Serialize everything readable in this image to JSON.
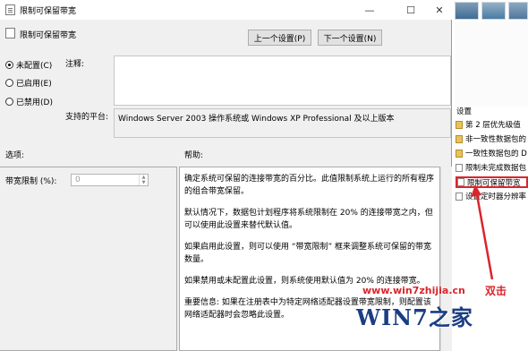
{
  "window": {
    "title": "限制可保留带宽",
    "controls": {
      "minimize": "—",
      "maximize": "☐",
      "close": "✕"
    }
  },
  "policy_header": "限制可保留带宽",
  "nav": {
    "prev": "上一个设置(P)",
    "next": "下一个设置(N)"
  },
  "state_options": [
    {
      "label": "未配置(C)",
      "selected": true
    },
    {
      "label": "已启用(E)",
      "selected": false
    },
    {
      "label": "已禁用(D)",
      "selected": false
    }
  ],
  "comment_label": "注释:",
  "supported_label": "支持的平台:",
  "supported_value": "Windows Server 2003 操作系统或 Windows XP Professional 及以上版本",
  "options_label": "选项:",
  "help_label": "帮助:",
  "bandwidth": {
    "label": "带宽限制 (%):",
    "value": "0"
  },
  "help_paragraphs": [
    "确定系统可保留的连接带宽的百分比。此值限制系统上运行的所有程序的组合带宽保留。",
    "默认情况下，数据包计划程序将系统限制在 20% 的连接带宽之内，但可以使用此设置来替代默认值。",
    "如果启用此设置，则可以使用 “带宽限制” 框来调整系统可保留的带宽数量。",
    "如果禁用或未配置此设置，则系统使用默认值为 20% 的连接带宽。",
    "重要信息: 如果在注册表中为特定网络适配器设置带宽限制，则配置该网络适配器时会忽略此设置。"
  ],
  "right_panel": {
    "header": "设置",
    "items": [
      {
        "label": "第 2 层优先级值",
        "icon": "folder"
      },
      {
        "label": "非一致性数据包的",
        "icon": "folder"
      },
      {
        "label": "一致性数据包的 D",
        "icon": "folder"
      },
      {
        "label": "限制未完成数据包",
        "icon": "policy"
      },
      {
        "label": "限制可保留带宽",
        "icon": "policy"
      },
      {
        "label": "设置定时器分辨率",
        "icon": "policy"
      }
    ]
  },
  "annotations": {
    "double_click": "双击",
    "watermark_url": "www.win7zhijia.cn",
    "watermark_logo": "WIN7之家"
  },
  "colors": {
    "annotation_red": "#d9262c",
    "dialog_bg": "#f0f0f0",
    "logo_blue": "#1b3d82"
  }
}
